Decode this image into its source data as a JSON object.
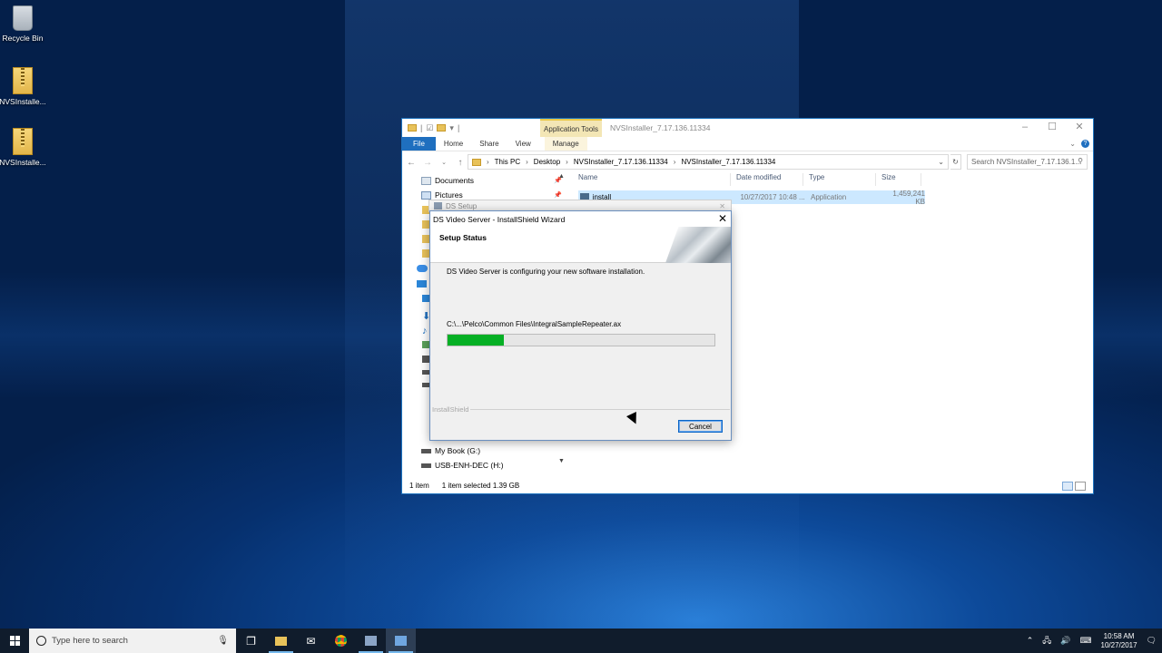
{
  "desktop": {
    "icons": [
      {
        "label": "Recycle Bin"
      },
      {
        "label": "NVSInstalle..."
      },
      {
        "label": "NVSInstalle..."
      }
    ]
  },
  "explorer": {
    "app_tools": "Application Tools",
    "title": "NVSInstaller_7.17.136.11334",
    "ribbon": {
      "file": "File",
      "home": "Home",
      "share": "Share",
      "view": "View",
      "manage": "Manage"
    },
    "breadcrumb": [
      "This PC",
      "Desktop",
      "NVSInstaller_7.17.136.11334",
      "NVSInstaller_7.17.136.11334"
    ],
    "search_placeholder": "Search NVSInstaller_7.17.136.1...",
    "nav_items": [
      {
        "label": "Documents",
        "icon": "documents-icon",
        "pinned": true
      },
      {
        "label": "Pictures",
        "icon": "pictures-icon",
        "pinned": true
      }
    ],
    "nav_drives": [
      {
        "label": "My Book (G:)",
        "icon": "drive-icon"
      },
      {
        "label": "USB-ENH-DEC (H:)",
        "icon": "drive-icon"
      }
    ],
    "columns": {
      "name": "Name",
      "date": "Date modified",
      "type": "Type",
      "size": "Size"
    },
    "file": {
      "name": "install",
      "date": "10/27/2017 10:48 ...",
      "type": "Application",
      "size": "1,459,241 KB"
    },
    "status": {
      "count": "1 item",
      "selected": "1 item selected  1.39 GB"
    }
  },
  "ds_setup": {
    "title": "DS Setup"
  },
  "wizard": {
    "title": "DS Video Server - InstallShield Wizard",
    "heading": "Setup Status",
    "message": "DS Video Server is configuring your new software installation.",
    "current_file": "C:\\...\\Pelco\\Common Files\\IntegralSampleRepeater.ax",
    "progress": 0.21,
    "brand": "InstallShield",
    "cancel": "Cancel"
  },
  "taskbar": {
    "search_placeholder": "Type here to search",
    "time": "10:58 AM",
    "date": "10/27/2017"
  }
}
